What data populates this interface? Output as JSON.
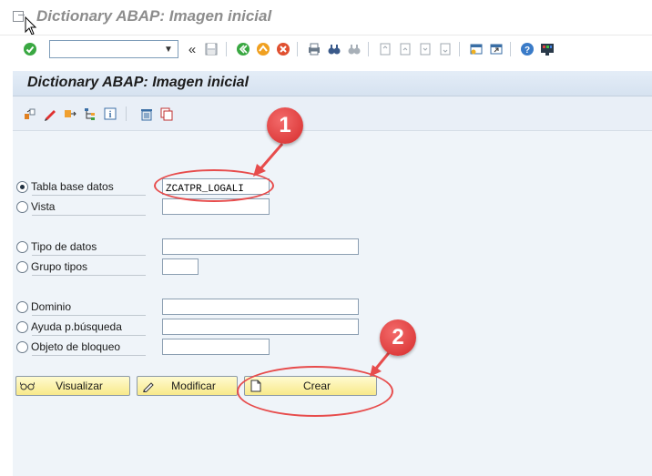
{
  "window": {
    "title": "Dictionary ABAP: Imagen inicial"
  },
  "toolbar": {
    "command_value": "",
    "icons": [
      "enter-icon",
      "save-icon",
      "back-icon",
      "exit-icon",
      "cancel-icon",
      "print-icon",
      "find-icon",
      "find-next-icon",
      "first-page-icon",
      "prev-page-icon",
      "next-page-icon",
      "last-page-icon",
      "new-session-icon",
      "shortcut-icon",
      "help-icon",
      "customize-layout-icon"
    ]
  },
  "screen": {
    "header": "Dictionary ABAP: Imagen inicial",
    "app_icons": [
      "other-object-icon",
      "edit-icon",
      "move-icon",
      "hierarchy-icon",
      "info-icon",
      "delete-icon",
      "copy-icon"
    ]
  },
  "form": {
    "options": [
      {
        "label": "Tabla base datos",
        "value": "ZCATPR_LOGALI",
        "checked": true
      },
      {
        "label": "Vista",
        "value": "",
        "checked": false
      },
      {
        "label": "Tipo de datos",
        "value": "",
        "checked": false
      },
      {
        "label": "Grupo tipos",
        "value": "",
        "checked": false
      },
      {
        "label": "Dominio",
        "value": "",
        "checked": false
      },
      {
        "label": "Ayuda p.búsqueda",
        "value": "",
        "checked": false
      },
      {
        "label": "Objeto de bloqueo",
        "value": "",
        "checked": false
      }
    ]
  },
  "buttons": {
    "display": "Visualizar",
    "change": "Modificar",
    "create": "Crear"
  },
  "annotations": {
    "badge1": "1",
    "badge2": "2"
  },
  "colors": {
    "annotation": "#e74c4c",
    "button": "#f8e98a",
    "header_bg": "#d6e2f0",
    "content_bg": "#eff4f9"
  }
}
